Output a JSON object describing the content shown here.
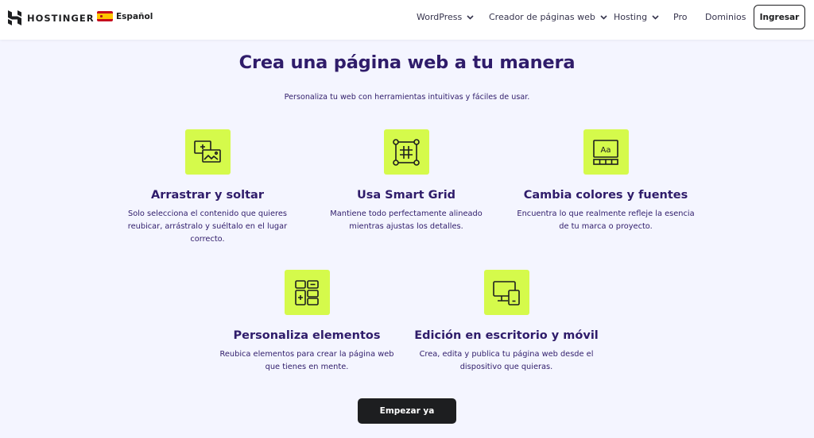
{
  "navbar": {
    "brand": "HOSTINGER",
    "language": "Español",
    "items": [
      {
        "label": "WordPress",
        "has_dropdown": true
      },
      {
        "label": "Creador de páginas web",
        "has_dropdown": true
      },
      {
        "label": "Hosting",
        "has_dropdown": true
      },
      {
        "label": "Pro",
        "has_dropdown": false
      },
      {
        "label": "Dominios",
        "has_dropdown": false
      }
    ],
    "login_label": "Ingresar"
  },
  "hero": {
    "title": "Crea una página web a tu manera",
    "subtitle": "Personaliza tu web con herramientas intuitivas y fáciles de usar."
  },
  "features": [
    {
      "icon": "drag-drop-images-icon",
      "title": "Arrastrar y soltar",
      "description": "Solo selecciona el contenido que quieres reubicar, arrástralo y suéltalo en el lugar correcto."
    },
    {
      "icon": "smart-grid-icon",
      "title": "Usa Smart Grid",
      "description": "Mantiene todo perfectamente alineado mientras ajustas los detalles."
    },
    {
      "icon": "fonts-colors-icon",
      "title": "Cambia colores y fuentes",
      "description": "Encuentra lo que realmente refleje la esencia de tu marca o proyecto."
    },
    {
      "icon": "layout-elements-icon",
      "title": "Personaliza elementos",
      "description": "Reubica elementos para crear la página web que tienes en mente."
    },
    {
      "icon": "desktop-mobile-icon",
      "title": "Edición en escritorio y móvil",
      "description": "Crea, edita y publica tu página web desde el dispositivo que quieras."
    }
  ],
  "cta": {
    "label": "Empezar ya"
  },
  "colors": {
    "accent": "#d5fa4b",
    "heading": "#2f1c6a",
    "dark": "#1d1e20",
    "background": "#f4f5ff"
  }
}
